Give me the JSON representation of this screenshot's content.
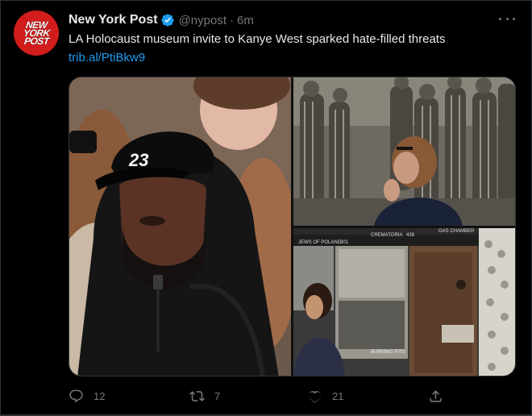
{
  "tweet": {
    "avatar_lines": [
      "NEW",
      "YORK",
      "POST"
    ],
    "display_name": "New York Post",
    "handle": "@nypost",
    "separator": "·",
    "time": "6m",
    "text": "LA Holocaust museum invite to Kanye West sparked hate-filled threats",
    "link": "trib.al/PtiBkw9",
    "media": {
      "cap_text": "23",
      "sign_texts": [
        "JEWS OF POLAND",
        "301",
        "CREMATORIA",
        "438",
        "GAS CHAMBER",
        "BURNING PITS"
      ]
    },
    "actions": {
      "reply_count": "12",
      "retweet_count": "7",
      "like_count": "21"
    }
  },
  "colors": {
    "background": "#000000",
    "text_primary": "#e7e9ea",
    "text_secondary": "#71767b",
    "link": "#1d9bf0",
    "verified": "#1d9bf0",
    "avatar_bg": "#d31c1c",
    "border": "#2f3336"
  },
  "icons": {
    "verified": "verified-badge-icon",
    "more": "more-icon",
    "reply": "reply-icon",
    "retweet": "retweet-icon",
    "like": "heart-icon",
    "share": "share-icon"
  }
}
